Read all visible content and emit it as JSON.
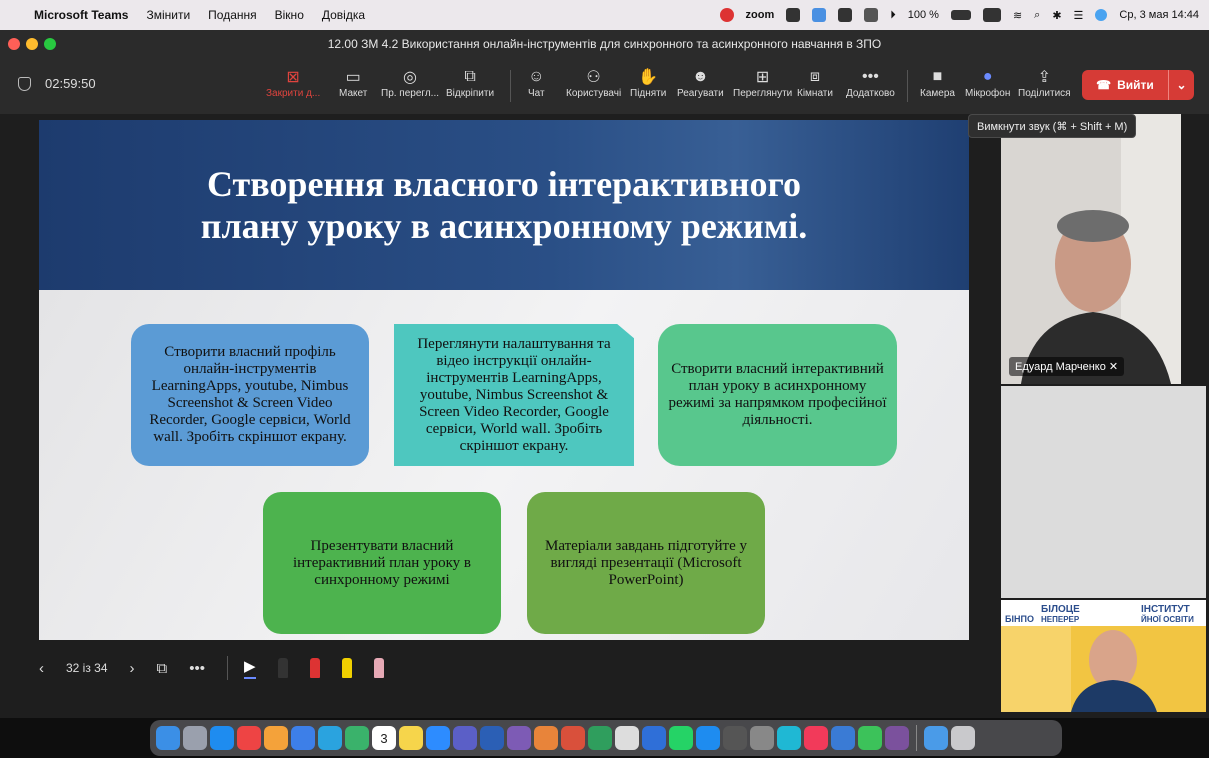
{
  "menubar": {
    "app": "Microsoft Teams",
    "items": [
      "Змінити",
      "Подання",
      "Вікно",
      "Довідка"
    ],
    "zoom_label": "zoom",
    "battery": "100 %",
    "datetime": "Ср, 3 мая  14:44"
  },
  "window": {
    "title": "12.00 ЗМ 4.2 Використання онлайн-інструментів для синхронного та асинхронного навчання в ЗПО"
  },
  "toolbar": {
    "timer": "02:59:50",
    "stop_share": "Закрити д...",
    "layout": "Макет",
    "preview": "Пр. перегл...",
    "popout": "Відкріпити",
    "chat": "Чат",
    "people": "Користувачі",
    "raise": "Підняти",
    "react": "Реагувати",
    "view": "Переглянути",
    "rooms": "Кімнати",
    "more": "Додатково",
    "camera": "Камера",
    "mic": "Мікрофон",
    "share": "Поділитися",
    "leave": "Вийти"
  },
  "tooltip": "Вимкнути звук (⌘ + Shift + M)",
  "slide": {
    "title": "Створення власного інтерактивного плану уроку в асинхронному режимі.",
    "cards": [
      "Створити власний профіль онлайн-інструментів LearningApps, youtube, Nimbus Screenshot & Screen Video Recorder, Google сервіси, World wall. Зробіть скріншот екрану.",
      "Переглянути налаштування та відео інструкції онлайн-інструментів LearningApps, youtube, Nimbus Screenshot & Screen Video Recorder, Google сервіси, World wall. Зробіть скріншот екрану.",
      "Створити власний інтерактивний план уроку в асинхронному режимі за напрямком професійної діяльності.",
      "Презентувати власний інтерактивний план уроку в синхронному режимі",
      "Матеріали завдань підготуйте у вигляді презентації (Microsoft PowerPoint)"
    ]
  },
  "slide_controls": {
    "page": "32 із 34"
  },
  "participants": {
    "name1": "Едуард Марченко",
    "banner_line1": "БІЛОЦЕ",
    "banner_line2": "НЕПЕРЕР",
    "banner_right1": "ІНСТИТУТ",
    "banner_right2": "ЙНОЇ ОСВІТИ",
    "banner_logo": "БІНПО"
  },
  "dock": {
    "calendar_day": "3"
  },
  "colors": {
    "leave_red": "#d63b36",
    "slide_blue": "#1d3b6e"
  }
}
